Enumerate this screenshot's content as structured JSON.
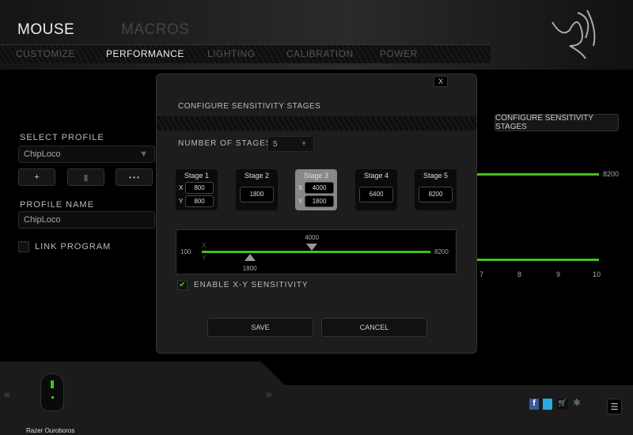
{
  "header": {
    "tabs": [
      {
        "label": "MOUSE",
        "active": true
      },
      {
        "label": "MACROS",
        "active": false
      }
    ],
    "subtabs": [
      {
        "label": "CUSTOMIZE"
      },
      {
        "label": "PERFORMANCE",
        "active": true
      },
      {
        "label": "LIGHTING"
      },
      {
        "label": "CALIBRATION"
      },
      {
        "label": "POWER"
      }
    ],
    "logo": "razer-snake-logo"
  },
  "sidebar": {
    "select_profile_label": "SELECT PROFILE",
    "profile_value": "ChipLoco",
    "add_label": "+",
    "delete_icon": "trash-icon",
    "more_label": "• • •",
    "profile_name_label": "PROFILE NAME",
    "profile_name_value": "ChipLoco",
    "link_program_label": "LINK PROGRAM"
  },
  "background": {
    "configure_button": "CONFIGURE SENSITIVITY STAGES",
    "max_label": "8200",
    "axis_ticks": [
      "7",
      "8",
      "9",
      "10"
    ]
  },
  "dialog": {
    "close_label": "X",
    "title": "CONFIGURE SENSITIVITY STAGES",
    "num_stages_label": "NUMBER OF STAGES",
    "num_stages_value": "5",
    "stages": [
      {
        "name": "Stage 1",
        "x": "800",
        "y": "800"
      },
      {
        "name": "Stage 2",
        "value": "1800"
      },
      {
        "name": "Stage 3",
        "x": "4000",
        "y": "1800",
        "selected": true
      },
      {
        "name": "Stage 4",
        "value": "6400"
      },
      {
        "name": "Stage 5",
        "value": "8200"
      }
    ],
    "slider": {
      "min": "100",
      "max": "8200",
      "x_label": "X",
      "y_label": "Y",
      "x_value": "4000",
      "y_value": "1800"
    },
    "enable_xy_label": "ENABLE X-Y SENSITIVITY",
    "enable_xy_checked": true,
    "save_label": "SAVE",
    "cancel_label": "CANCEL"
  },
  "footer": {
    "device_name": "Razer Ouroboros",
    "prev": "«",
    "next": "»",
    "icons": [
      "facebook-icon",
      "twitter-icon",
      "cart-icon",
      "razer-icon"
    ],
    "menu_icon": "menu-icon"
  },
  "colors": {
    "accent": "#44c01f"
  }
}
